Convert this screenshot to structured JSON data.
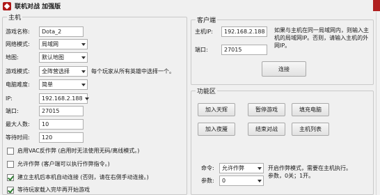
{
  "window": {
    "title": "联机对战 加强版"
  },
  "host": {
    "group_title": "主机",
    "game_name_label": "游戏名称:",
    "game_name_value": "Dota_2",
    "network_mode_label": "网络模式:",
    "network_mode_value": "局域网",
    "map_label": "地图:",
    "map_value": "默认地图",
    "game_mode_label": "游戏模式:",
    "game_mode_value": "全阵营选择",
    "game_mode_hint": "每个玩家从所有英雄中选择一个。",
    "difficulty_label": "电脑难度:",
    "difficulty_value": "简单",
    "ip_label": "IP:",
    "ip_value": "192.168.2.188",
    "port_label": "端口:",
    "port_value": "27015",
    "max_players_label": "最大人数:",
    "max_players_value": "10",
    "wait_time_label": "等待时间:",
    "wait_time_value": "120",
    "vac_label": "启用VAC反作弊 (启用时无法使用无码/离线模式。)",
    "cheat_label": "允许作弊 (客户端可以执行作弊指令。)",
    "auto_connect_label": "建立主机后本机自动连接 (否则，请在右侧手动连接。)",
    "wait_all_label": "等待玩家载入完毕再开始游戏"
  },
  "client": {
    "group_title": "客户端",
    "host_ip_label": "主机IP:",
    "host_ip_value": "192.168.2.188",
    "port_label": "端口:",
    "port_value": "27015",
    "desc_lines": [
      "如果与主机在同一局域网内，则输入主",
      "机的局域网IP。否则，请输入主机的外",
      "网IP。"
    ],
    "connect_button": "连接"
  },
  "functions": {
    "group_title": "功能区",
    "buttons": [
      "加入天辉",
      "暂停游戏",
      "填充电脑",
      "加入夜魇",
      "结束对战",
      "主机列表"
    ],
    "command_label": "命令:",
    "command_value": "允许作弊",
    "param_label": "参数:",
    "param_value": "0",
    "desc_lines": [
      "开启作弊模式，需要在主机执行。",
      "参数，0关；1开。"
    ]
  },
  "colors": {
    "background": "#f0f0f0",
    "close_red": "#b02020",
    "check_green": "#2e7d32"
  }
}
